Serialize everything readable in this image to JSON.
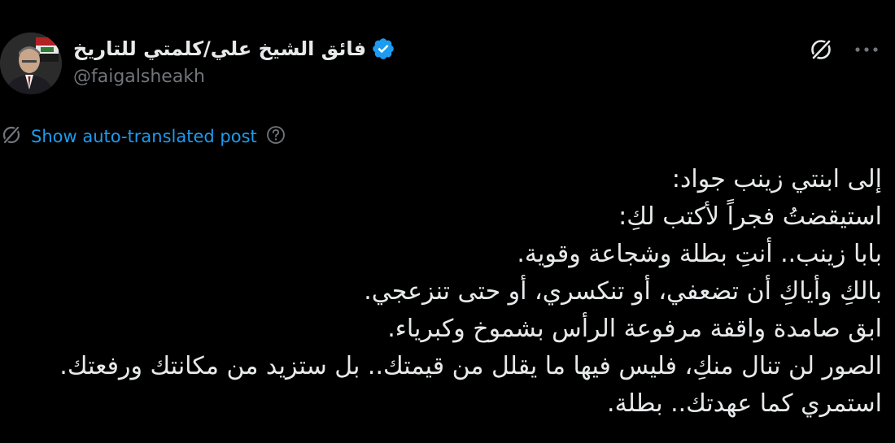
{
  "author": {
    "display_name": "فائق الشيخ علي/كلمتي للتاريخ",
    "handle": "@faigalsheakh",
    "verified": true,
    "avatar_icon": "avatar-photo"
  },
  "actions": {
    "translate_icon": "translate-icon",
    "more_icon": "more-icon"
  },
  "translate": {
    "label": "Show auto-translated post",
    "icon": "translate-slash-icon",
    "help_icon": "question-circle-icon"
  },
  "post": {
    "lines": [
      "إلى ابنتي زينب جواد:",
      "استيقضتُ فجراً لأكتب لكِ:",
      "بابا زينب.. أنتِ بطلة وشجاعة وقوية.",
      "بالكِ وأياكِ أن تضعفي، أو تنكسري، أو حتى تنزعجي.",
      "ابق صامدة واقفة مرفوعة الرأس بشموخ وكبرياء.",
      "الصور لن تنال منكِ، فليس فيها ما يقلل من قيمتك.. بل ستزيد من مكانتك ورفعتك.",
      "استمري كما عهدتك.. بطلة."
    ]
  },
  "colors": {
    "background": "#000000",
    "text": "#e7e9ea",
    "secondary": "#71767b",
    "link": "#1d9bf0",
    "verified": "#1d9bf0"
  }
}
